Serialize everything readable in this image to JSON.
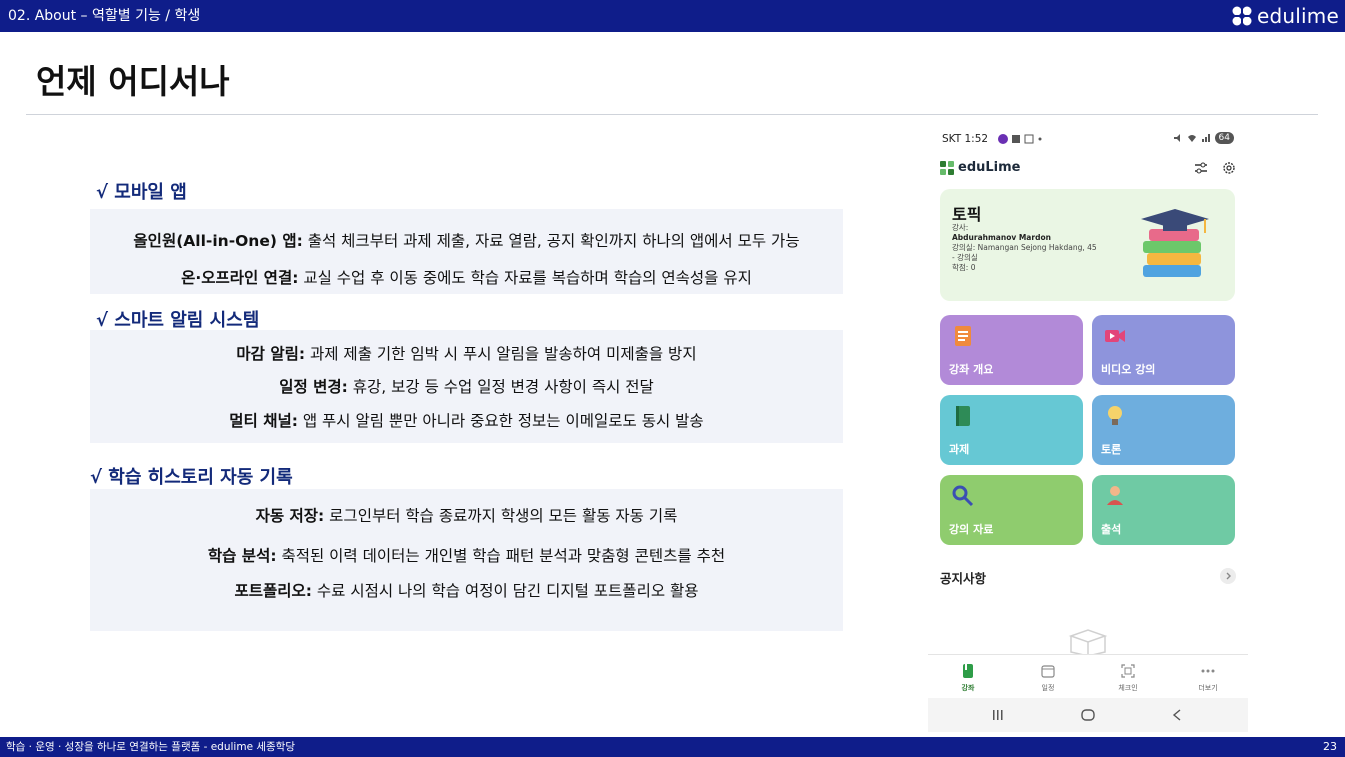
{
  "header": {
    "breadcrumb": "02. About – 역할별 기능 / 학생",
    "brand": "edulime"
  },
  "page_title": "언제 어디서나",
  "sections": [
    {
      "heading": "√ 모바일 앱",
      "lines": [
        {
          "bold": "올인원(All-in-One) 앱:",
          "text": " 출석 체크부터 과제 제출, 자료 열람, 공지 확인까지 하나의 앱에서 모두 가능"
        },
        {
          "bold": "온·오프라인 연결:",
          "text": " 교실 수업 후 이동 중에도 학습 자료를 복습하며 학습의 연속성을 유지"
        }
      ]
    },
    {
      "heading": "√ 스마트 알림 시스템",
      "lines": [
        {
          "bold": "마감 알림:",
          "text": " 과제 제출 기한 임박 시 푸시 알림을 발송하여 미제출을 방지"
        },
        {
          "bold": "일정 변경:",
          "text": " 휴강, 보강 등 수업 일정 변경 사항이 즉시 전달"
        },
        {
          "bold": "멀티 채널:",
          "text": " 앱 푸시 알림 뿐만 아니라 중요한 정보는 이메일로도 동시 발송"
        }
      ]
    },
    {
      "heading": "√ 학습 히스토리 자동 기록",
      "lines": [
        {
          "bold": "자동 저장:",
          "text": " 로그인부터 학습 종료까지 학생의 모든 활동 자동 기록"
        },
        {
          "bold": "학습 분석:",
          "text": " 축적된 이력 데이터는 개인별 학습 패턴 분석과 맞춤형 콘텐츠를 추천"
        },
        {
          "bold": "포트폴리오:",
          "text": " 수료 시점시 나의 학습 여정이 담긴 디지털 포트폴리오 활용"
        }
      ]
    }
  ],
  "phone": {
    "status": {
      "time": "SKT 1:52",
      "battery": "64"
    },
    "app_name": "eduLime",
    "topic": {
      "title": "토픽",
      "teacher_label": "강사:",
      "teacher_name": "Abdurahmanov Mardon",
      "room": "강의실: Namangan Sejong Hakdang, 45",
      "room_extra": "- 강의실",
      "credits": "학점: 0"
    },
    "tiles": [
      {
        "label": "강좌 개요",
        "color": "#b28ad8",
        "icon": "document-icon"
      },
      {
        "label": "비디오 강의",
        "color": "#8e94dc",
        "icon": "video-camera-icon"
      },
      {
        "label": "과제",
        "color": "#66c8d4",
        "icon": "notebook-icon"
      },
      {
        "label": "토론",
        "color": "#6eaede",
        "icon": "lightbulb-icon"
      },
      {
        "label": "강의 자료",
        "color": "#8fcc6e",
        "icon": "magnifier-icon"
      },
      {
        "label": "출석",
        "color": "#6fcaa4",
        "icon": "person-icon"
      }
    ],
    "notice_label": "공지사항",
    "nav": [
      {
        "label": "강좌",
        "icon": "course-icon",
        "active": true
      },
      {
        "label": "일정",
        "icon": "calendar-icon",
        "active": false
      },
      {
        "label": "체크인",
        "icon": "qr-scan-icon",
        "active": false
      },
      {
        "label": "더보기",
        "icon": "more-icon",
        "active": false
      }
    ]
  },
  "footer": {
    "text": "학습 · 운영 · 성장을 하나로  연결하는 플랫폼 - edulime 세종학당",
    "page": "23"
  }
}
